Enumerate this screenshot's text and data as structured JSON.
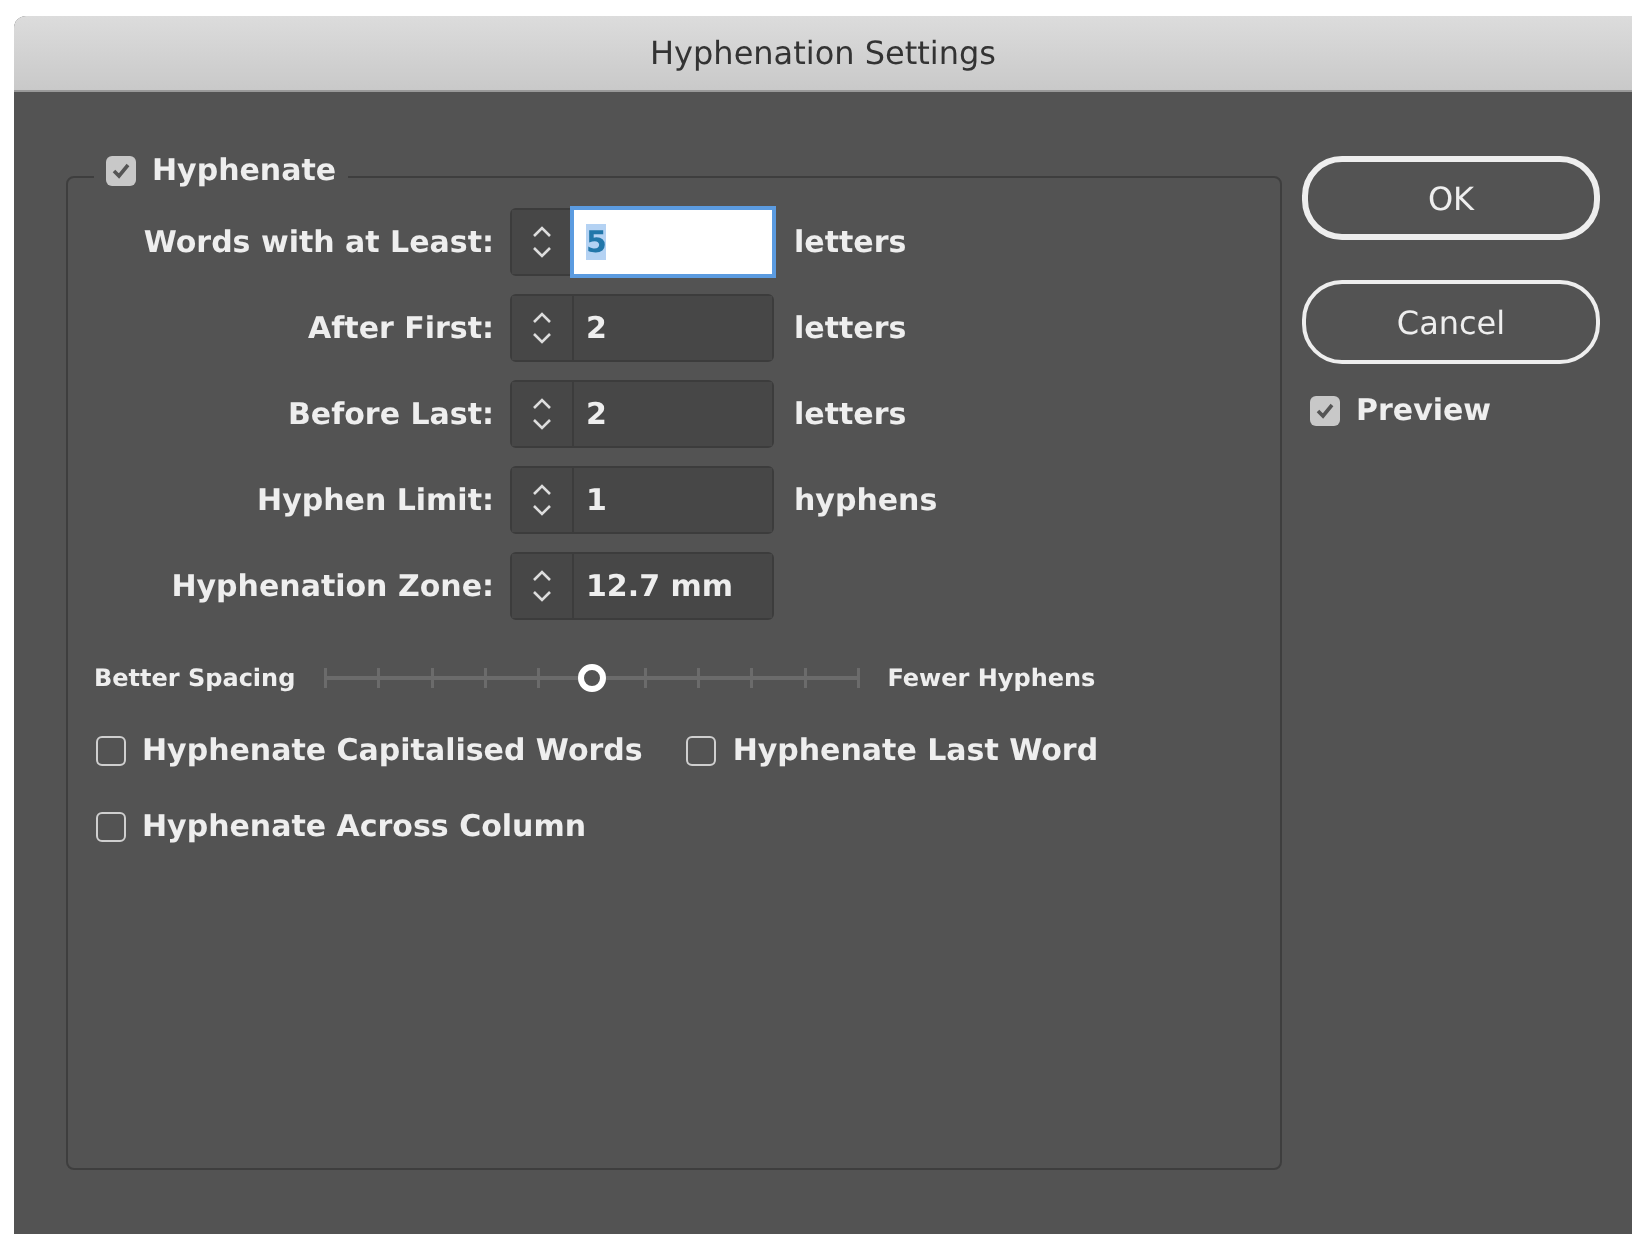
{
  "window": {
    "title": "Hyphenation Settings"
  },
  "hyphenate": {
    "label": "Hyphenate",
    "checked": true
  },
  "fields": [
    {
      "label": "Words with at Least:",
      "value": "5",
      "unit": "letters",
      "focused": true
    },
    {
      "label": "After First:",
      "value": "2",
      "unit": "letters",
      "focused": false
    },
    {
      "label": "Before Last:",
      "value": "2",
      "unit": "letters",
      "focused": false
    },
    {
      "label": "Hyphen Limit:",
      "value": "1",
      "unit": "hyphens",
      "focused": false
    },
    {
      "label": "Hyphenation Zone:",
      "value": "12.7 mm",
      "focused": false
    }
  ],
  "slider": {
    "left_label": "Better Spacing",
    "right_label": "Fewer Hyphens",
    "level": 0.5
  },
  "options": [
    {
      "label": "Hyphenate Capitalised Words",
      "checked": false
    },
    {
      "label": "Hyphenate Last Word",
      "checked": false
    },
    {
      "label": "Hyphenate Across Column",
      "checked": false
    }
  ],
  "buttons": [
    {
      "label": "OK",
      "default": true
    },
    {
      "label": "Cancel",
      "default": false
    }
  ],
  "preview": {
    "label": "Preview",
    "checked": true
  }
}
